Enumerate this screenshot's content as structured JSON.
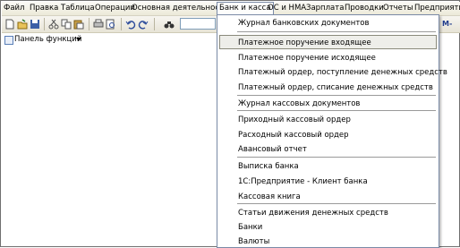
{
  "menubar": {
    "items": [
      "Файл",
      "Правка",
      "Таблица",
      "Операции",
      "Основная деятельность",
      "Банк и касса",
      "ОС и НМА",
      "Зарплата",
      "Проводки",
      "Отчеты",
      "Предприятие"
    ]
  },
  "toolbar": {
    "search_value": "",
    "m_label": "M-"
  },
  "function_panel": {
    "label": "Панель функций"
  },
  "dropdown": {
    "items": [
      "Журнал банковских документов",
      "Платежное поручение входящее",
      "Платежное поручение исходящее",
      "Платежный ордер, поступление денежных средств",
      "Платежный ордер, списание денежных средств",
      "Журнал кассовых документов",
      "Приходный кассовый ордер",
      "Расходный кассовый ордер",
      "Авансовый отчет",
      "Выписка банка",
      "1С:Предприятие - Клиент банка",
      "Кассовая книга",
      "Статьи движения денежных средств",
      "Банки",
      "Валюты"
    ],
    "selected_index": 1
  }
}
